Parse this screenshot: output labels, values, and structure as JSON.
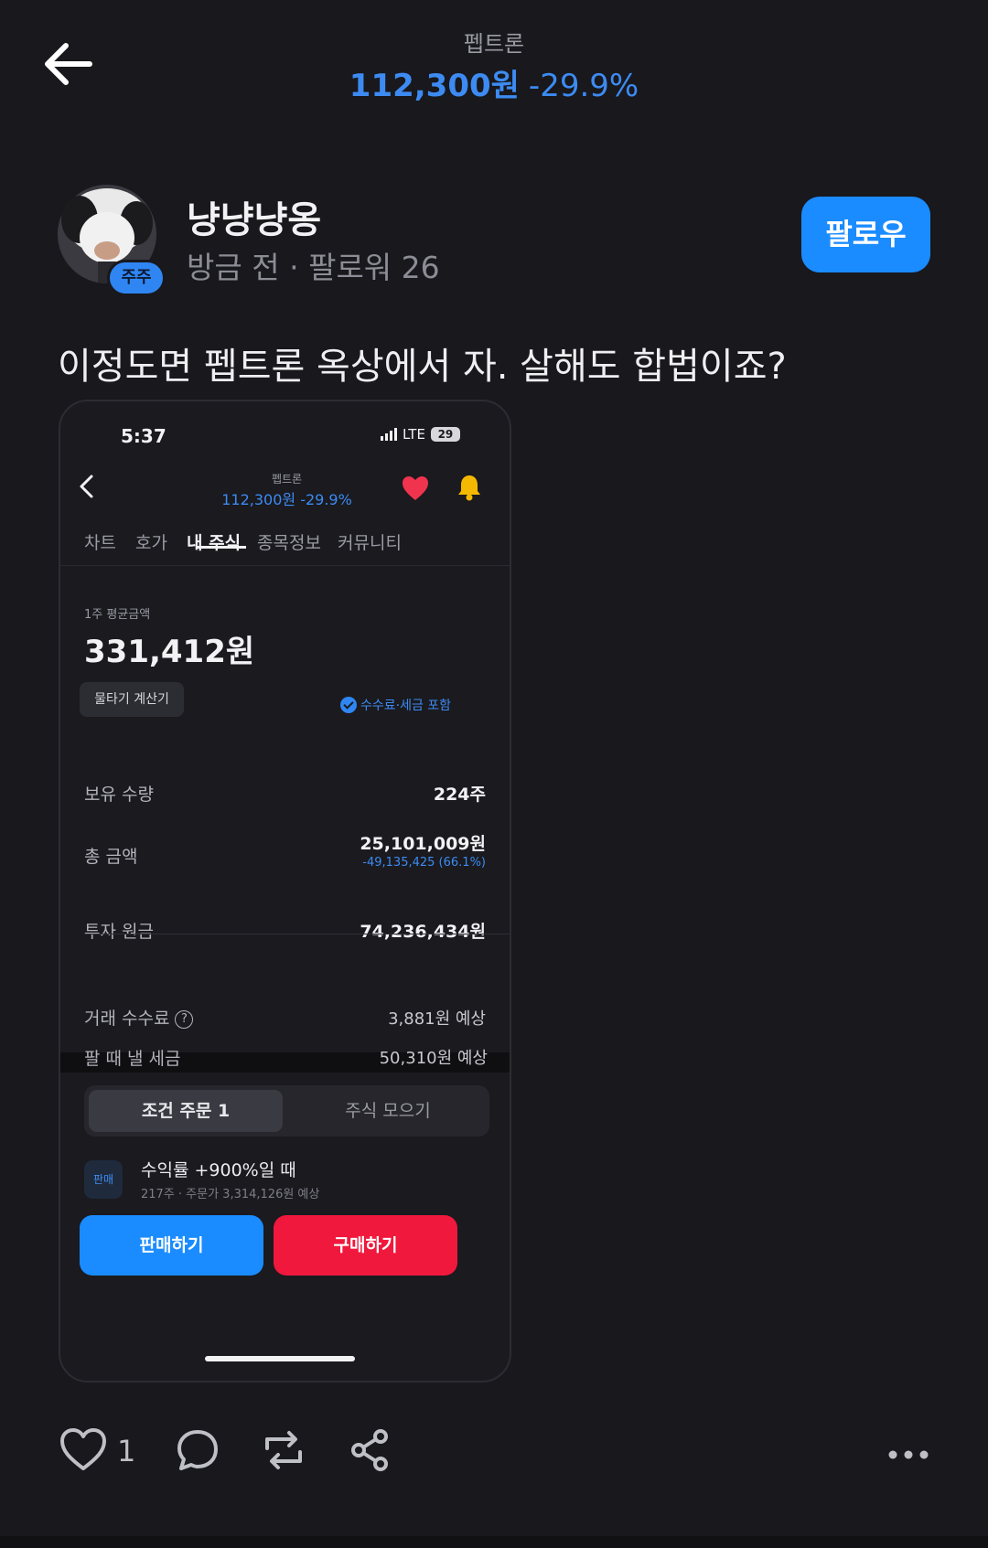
{
  "header": {
    "stock_name": "펩트론",
    "price": "112,300원",
    "change": "-29.9%"
  },
  "author": {
    "name": "냥냥냥옹",
    "badge": "주주",
    "time": "방금 전",
    "separator": "·",
    "followers": "팔로워 26"
  },
  "follow_label": "팔로우",
  "post_text": "이정도면 펩트론 옥상에서 자. 살해도 합법이죠?",
  "screenshot": {
    "status_time": "5:37",
    "network": "LTE",
    "battery": "29",
    "stock_name": "펩트론",
    "price": "112,300원",
    "change": "-29.9%",
    "tabs": [
      "차트",
      "호가",
      "내 주식",
      "종목정보",
      "커뮤니티"
    ],
    "active_tab": "내 주식",
    "avg_label": "1주 평균금액",
    "avg_value": "331,412원",
    "calc_button": "물타기 계산기",
    "fee_note": "수수료·세금 포함",
    "rows": {
      "qty_label": "보유 수량",
      "qty_value": "224주",
      "total_label": "총 금액",
      "total_value": "25,101,009원",
      "total_sub": "-49,135,425 (66.1%)",
      "principal_label": "투자 원금",
      "principal_value": "74,236,434원",
      "fee_label": "거래 수수료",
      "fee_value": "3,881원 예상",
      "tax_label": "팔 때 낼 세금",
      "tax_value": "50,310원 예상"
    },
    "segments": [
      "조건 주문 1",
      "주식 모으기"
    ],
    "order": {
      "tag": "판매",
      "title": "수익률 +900%일 때",
      "sub": "217주 · 주문가 3,314,126원 예상"
    },
    "sell_button": "판매하기",
    "buy_button": "구매하기"
  },
  "actions": {
    "like_count": "1"
  },
  "colors": {
    "accent_blue": "#1a8cff",
    "price_blue": "#3d8bf2",
    "buy_red": "#f0183c",
    "background": "#18181d"
  },
  "icons": [
    "back-arrow-icon",
    "heart-icon",
    "bell-icon",
    "comment-icon",
    "repost-icon",
    "share-icon",
    "more-icon",
    "info-icon",
    "check-icon"
  ]
}
